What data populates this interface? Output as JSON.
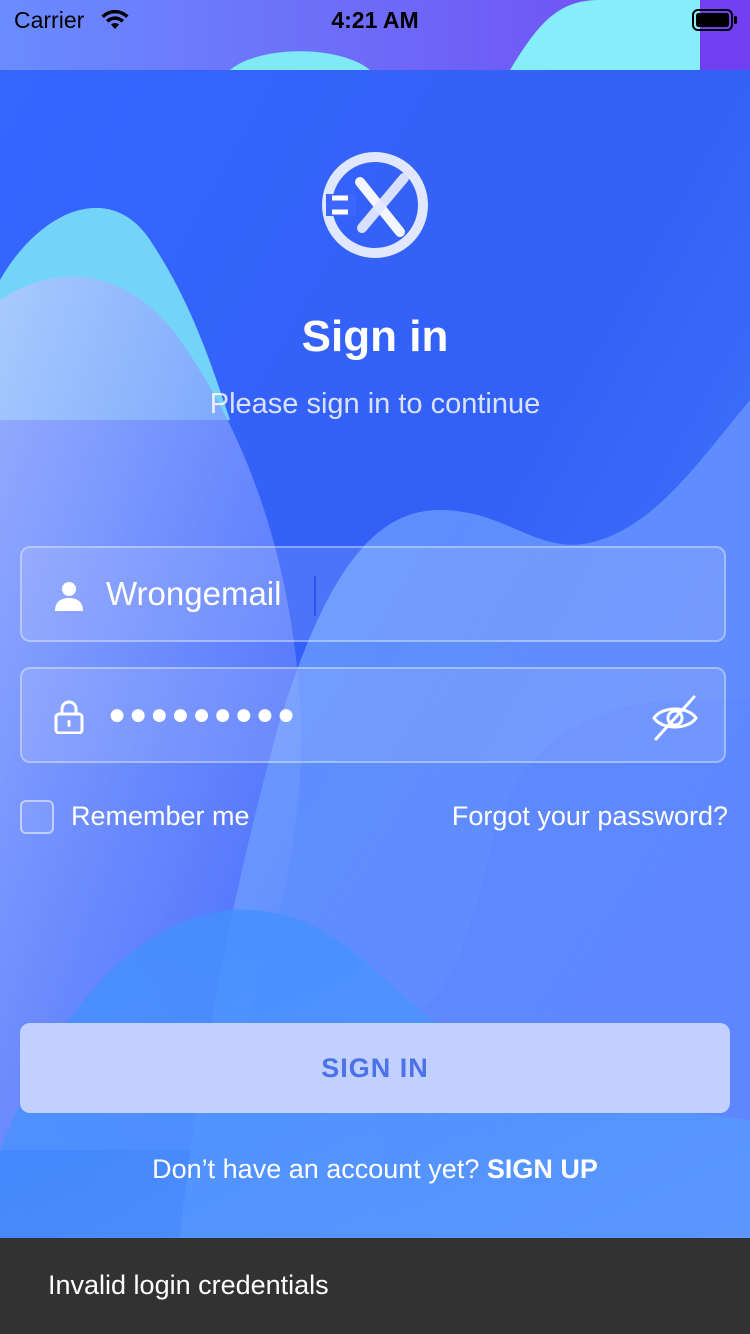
{
  "status_bar": {
    "carrier": "Carrier",
    "time": "4:21 AM",
    "wifi_icon": "wifi-icon",
    "battery_icon": "battery-icon"
  },
  "logo": {
    "icon": "app-logo-icon"
  },
  "header": {
    "title": "Sign in",
    "subtitle": "Please sign in to continue"
  },
  "form": {
    "email": {
      "value": "Wrongemail",
      "icon": "user-icon"
    },
    "password": {
      "masked_value": "●●●●●●●●●",
      "icon": "lock-icon",
      "toggle_icon": "eye-off-icon"
    },
    "remember_label": "Remember me",
    "remember_checked": false,
    "forgot_label": "Forgot your password?"
  },
  "actions": {
    "signin_label": "SIGN IN",
    "signup_prompt": "Don’t have an account yet?",
    "signup_label": "SIGN UP"
  },
  "snackbar": {
    "message": "Invalid login credentials"
  },
  "colors": {
    "background_primary": "#2f63ff",
    "background_secondary": "#5aa4ff",
    "accent_cyan": "#7ff0fb",
    "button_bg": "#c2d0ff",
    "button_text": "#4b72e6",
    "snackbar_bg": "#323232"
  }
}
